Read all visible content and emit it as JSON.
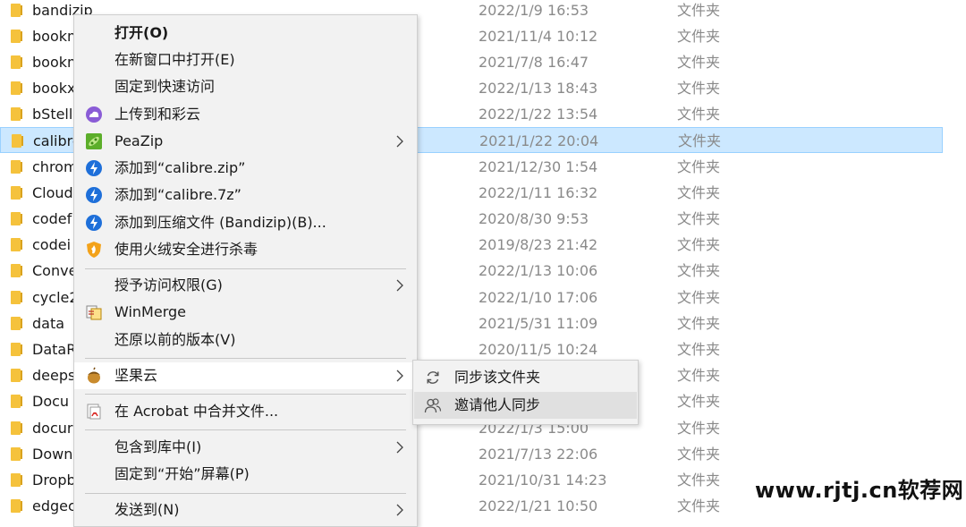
{
  "files": [
    {
      "name": "bandizip",
      "date": "2022/1/9 16:53",
      "type": "文件夹"
    },
    {
      "name": "bookm",
      "date": "2021/11/4 10:12",
      "type": "文件夹"
    },
    {
      "name": "bookm",
      "date": "2021/7/8 16:47",
      "type": "文件夹"
    },
    {
      "name": "bookx",
      "date": "2022/1/13 18:43",
      "type": "文件夹"
    },
    {
      "name": "bStell",
      "date": "2022/1/22 13:54",
      "type": "文件夹"
    },
    {
      "name": "calibre",
      "date": "2021/1/22 20:04",
      "type": "文件夹"
    },
    {
      "name": "chrom",
      "date": "2021/12/30 1:54",
      "type": "文件夹"
    },
    {
      "name": "Cloud",
      "date": "2022/1/11 16:32",
      "type": "文件夹"
    },
    {
      "name": "codef",
      "date": "2020/8/30 9:53",
      "type": "文件夹"
    },
    {
      "name": "codei",
      "date": "2019/8/23 21:42",
      "type": "文件夹"
    },
    {
      "name": "Conve",
      "date": "2022/1/13 10:06",
      "type": "文件夹"
    },
    {
      "name": "cycle2",
      "date": "2022/1/10 17:06",
      "type": "文件夹"
    },
    {
      "name": "data",
      "date": "2021/5/31 11:09",
      "type": "文件夹"
    },
    {
      "name": "DataR",
      "date": "2020/11/5 10:24",
      "type": "文件夹"
    },
    {
      "name": "deeps",
      "date": "",
      "type": "文件夹"
    },
    {
      "name": "Docu",
      "date": "",
      "type": "文件夹"
    },
    {
      "name": "docur",
      "date": "2022/1/3 15:00",
      "type": "文件夹"
    },
    {
      "name": "Down",
      "date": "2021/7/13 22:06",
      "type": "文件夹"
    },
    {
      "name": "Dropb",
      "date": "2021/10/31 14:23",
      "type": "文件夹"
    },
    {
      "name": "edgec",
      "date": "2022/1/21 10:50",
      "type": "文件夹"
    }
  ],
  "menu": {
    "items": [
      {
        "label": "打开(O)",
        "bold": true,
        "icon": ""
      },
      {
        "label": "在新窗口中打开(E)",
        "icon": ""
      },
      {
        "label": "固定到快速访问",
        "icon": ""
      },
      {
        "label": "上传到和彩云",
        "icon": "caiyun-cloud-icon"
      },
      {
        "label": "PeaZip",
        "icon": "peazip-icon",
        "submenu": true
      },
      {
        "label": "添加到“calibre.zip”",
        "icon": "bandizip-icon"
      },
      {
        "label": "添加到“calibre.7z”",
        "icon": "bandizip-icon"
      },
      {
        "label": "添加到压缩文件 (Bandizip)(B)...",
        "icon": "bandizip-icon"
      },
      {
        "label": "使用火绒安全进行杀毒",
        "icon": "huorong-shield-icon"
      },
      {
        "label": "授予访问权限(G)",
        "icon": "",
        "submenu": true
      },
      {
        "label": "WinMerge",
        "icon": "winmerge-icon"
      },
      {
        "label": "还原以前的版本(V)",
        "icon": ""
      },
      {
        "label": "坚果云",
        "icon": "jianguoyun-nut-icon",
        "submenu": true
      },
      {
        "label": "在 Acrobat 中合并文件...",
        "icon": "acrobat-icon"
      },
      {
        "label": "包含到库中(I)",
        "icon": "",
        "submenu": true
      },
      {
        "label": "固定到“开始”屏幕(P)",
        "icon": ""
      },
      {
        "label": "发送到(N)",
        "icon": "",
        "submenu": true
      }
    ]
  },
  "submenu": {
    "items": [
      {
        "label": "同步该文件夹",
        "icon": "sync-icon"
      },
      {
        "label": "邀请他人同步",
        "icon": "invite-users-icon"
      }
    ]
  },
  "watermark": "www.rjtj.cn软荐网",
  "colors": {
    "selection": "#cce8ff",
    "folder": "#f5c23c",
    "bandizip": "#1e6fd9"
  }
}
